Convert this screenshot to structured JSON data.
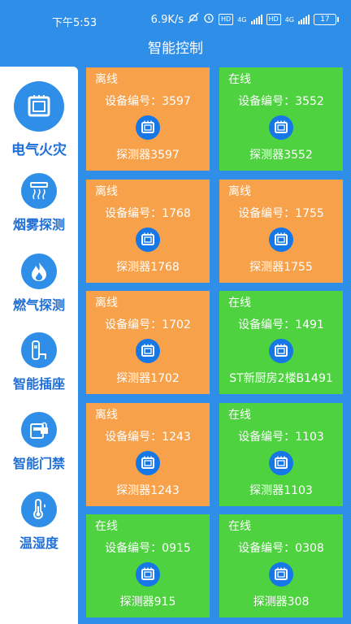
{
  "statusbar": {
    "time": "下午5:53",
    "speed": "6.9K/s",
    "hd1": "HD",
    "hd2": "HD",
    "net1": "4G",
    "net2": "4G",
    "battery": "17"
  },
  "header": {
    "title": "智能控制"
  },
  "colors": {
    "primary": "#2f8ee8",
    "offline": "#f7a14b",
    "online": "#4ed240",
    "icon_bg": "#1677e6",
    "label": "#1f6fd6"
  },
  "sidebar": {
    "items": [
      {
        "label": "电气火灾",
        "icon": "electric-panel-icon",
        "active": true
      },
      {
        "label": "烟雾探测",
        "icon": "smoke-detector-icon",
        "active": false
      },
      {
        "label": "燃气探测",
        "icon": "flame-icon",
        "active": false
      },
      {
        "label": "智能插座",
        "icon": "socket-icon",
        "active": false
      },
      {
        "label": "智能门禁",
        "icon": "door-lock-icon",
        "active": false
      },
      {
        "label": "温湿度",
        "icon": "thermometer-icon",
        "active": false
      }
    ]
  },
  "devices": [
    {
      "status": "离线",
      "number_label": "设备编号：3597",
      "name": "探测器3597",
      "online": false
    },
    {
      "status": "在线",
      "number_label": "设备编号：3552",
      "name": "探测器3552",
      "online": true
    },
    {
      "status": "离线",
      "number_label": "设备编号：1768",
      "name": "探测器1768",
      "online": false
    },
    {
      "status": "离线",
      "number_label": "设备编号：1755",
      "name": "探测器1755",
      "online": false
    },
    {
      "status": "离线",
      "number_label": "设备编号：1702",
      "name": "探测器1702",
      "online": false
    },
    {
      "status": "在线",
      "number_label": "设备编号：1491",
      "name": "ST新厨房2楼B1491",
      "online": true
    },
    {
      "status": "离线",
      "number_label": "设备编号：1243",
      "name": "探测器1243",
      "online": false
    },
    {
      "status": "在线",
      "number_label": "设备编号：1103",
      "name": "探测器1103",
      "online": true
    },
    {
      "status": "在线",
      "number_label": "设备编号：0915",
      "name": "探测器915",
      "online": true
    },
    {
      "status": "在线",
      "number_label": "设备编号：0308",
      "name": "探测器308",
      "online": true
    }
  ]
}
